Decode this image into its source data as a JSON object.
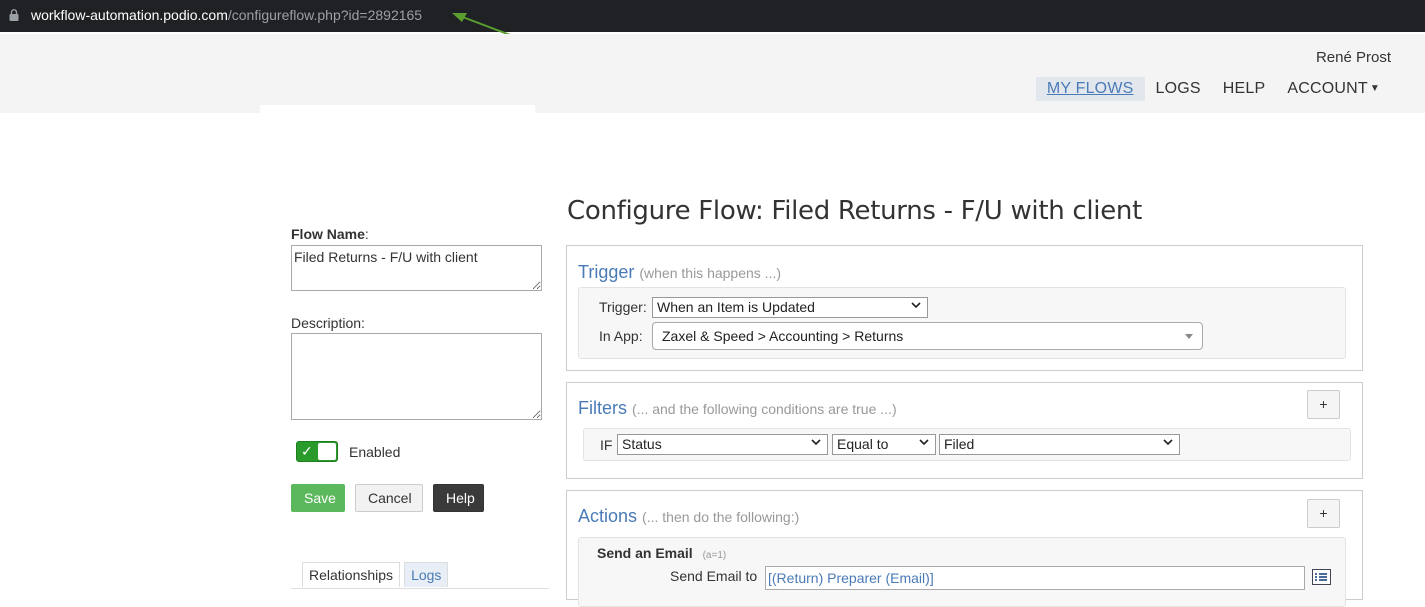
{
  "browser": {
    "url_host": "workflow-automation.podio.com",
    "url_path": "/configureflow.php?id=2892165",
    "arrow_color": "#5a9e2f"
  },
  "header": {
    "user_name": "René Prost",
    "nav": [
      {
        "label": "MY FLOWS",
        "active": true
      },
      {
        "label": "LOGS"
      },
      {
        "label": "HELP"
      },
      {
        "label": "ACCOUNT"
      }
    ]
  },
  "page": {
    "title": "Configure Flow: Filed Returns - F/U with client"
  },
  "form": {
    "flow_name_label": "Flow Name",
    "flow_name_value": "Filed Returns - F/U with client",
    "description_label": "Description:",
    "description_value": "",
    "enabled_label": "Enabled",
    "enabled": true,
    "save_label": "Save",
    "cancel_label": "Cancel",
    "help_label": "Help",
    "tabs": [
      {
        "label": "Relationships",
        "active": true
      },
      {
        "label": "Logs"
      }
    ]
  },
  "trigger": {
    "title": "Trigger",
    "subtitle": "(when this happens ...)",
    "trigger_label": "Trigger:",
    "trigger_value": "When an Item is Updated",
    "app_label": "In App:",
    "app_value": "Zaxel & Speed > Accounting > Returns"
  },
  "filters": {
    "title": "Filters",
    "subtitle": "(... and the following conditions are true ...)",
    "add_label": "+",
    "if_label": "IF",
    "field_value": "Status",
    "operator_value": "Equal to",
    "compare_value": "Filed"
  },
  "actions": {
    "title": "Actions",
    "subtitle": "(... then do the following:)",
    "add_label": "+",
    "action_title": "Send an Email",
    "action_id": "(a=1)",
    "send_to_label": "Send Email to",
    "send_to_value": "[(Return) Preparer (Email)]"
  },
  "colors": {
    "accent": "#4a7bb7",
    "save_green": "#5cb85c",
    "toggle_green": "#2a9a2a",
    "help_dark": "#3a3a3a"
  }
}
